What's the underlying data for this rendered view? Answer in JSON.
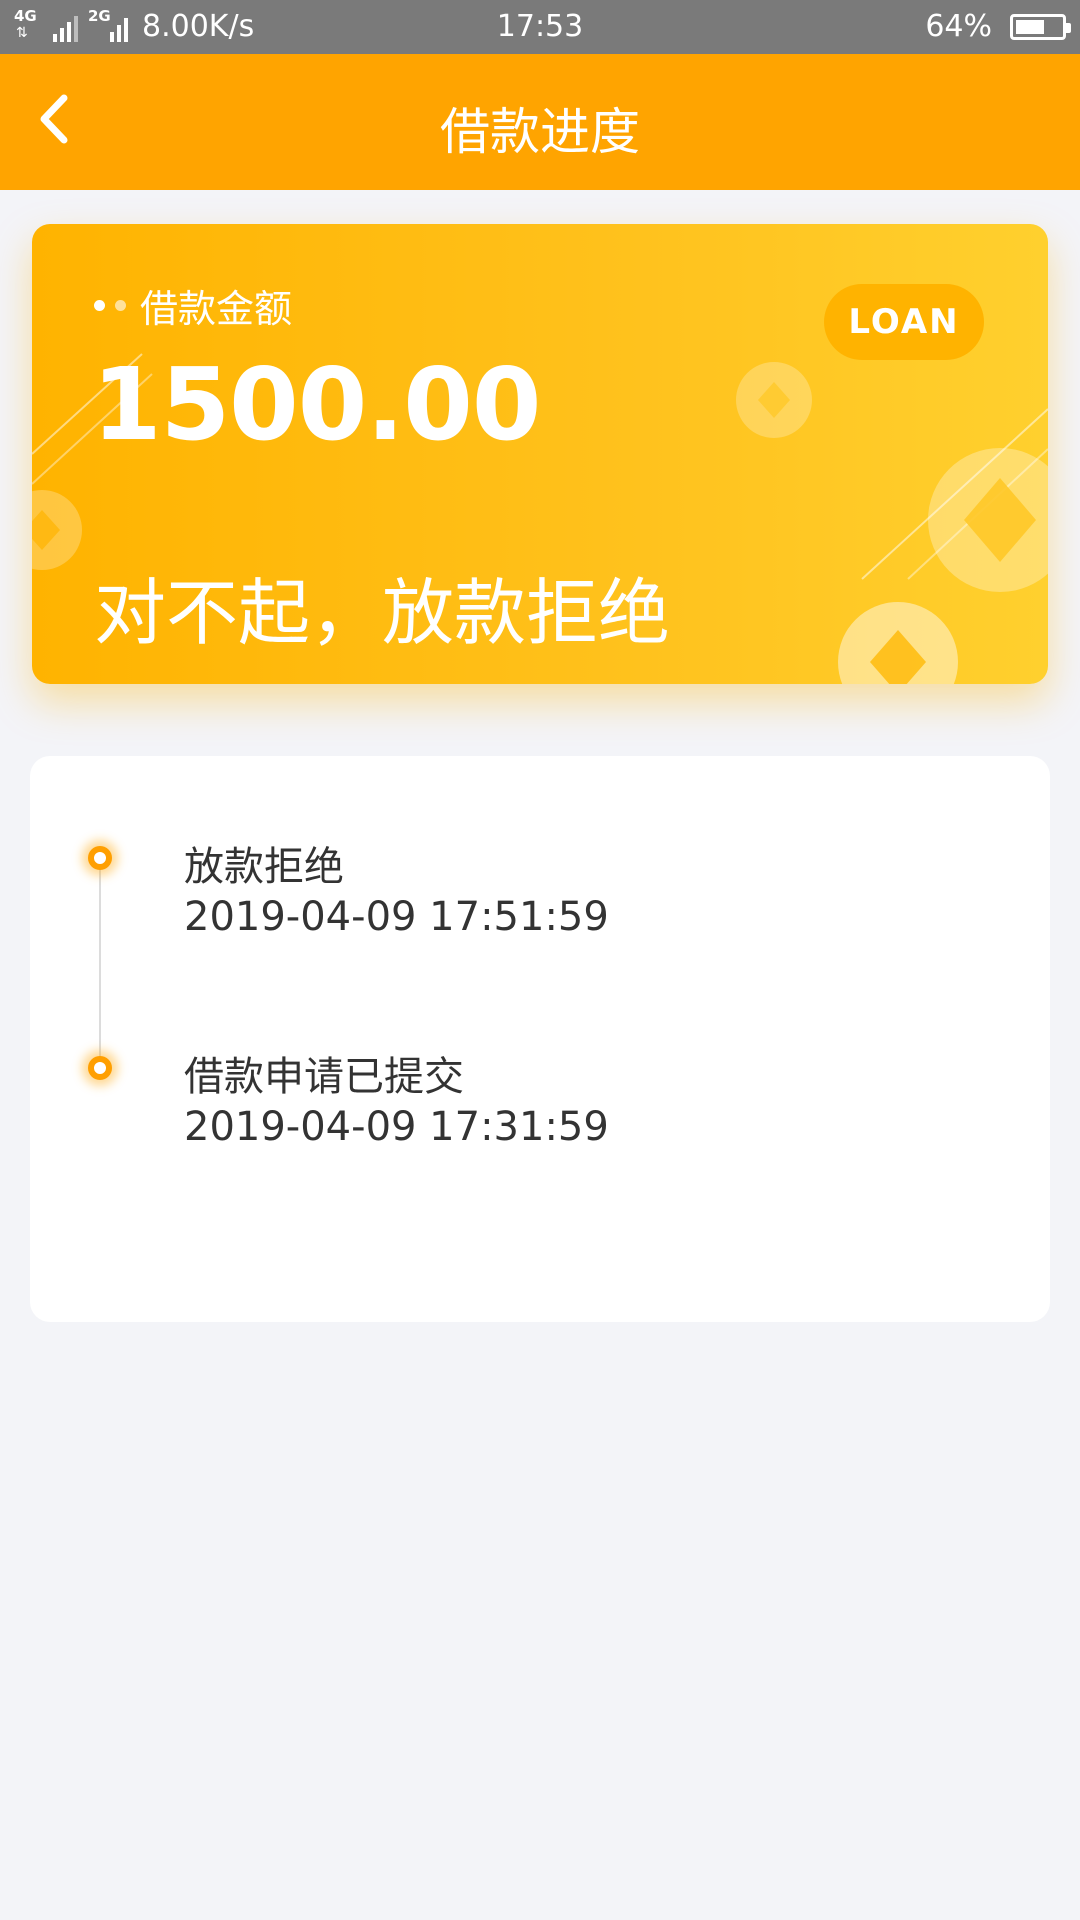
{
  "status_bar": {
    "network_1": "4G",
    "network_1b": "4G",
    "network_2": "2G",
    "speed": "8.00K/s",
    "time": "17:53",
    "battery": "64%",
    "battery_level": 0.64
  },
  "header": {
    "title": "借款进度",
    "back_icon": "chevron-left-icon"
  },
  "loan_card": {
    "amount_label": "借款金额",
    "amount": "1500.00",
    "badge": "LOAN",
    "status": "对不起，放款拒绝",
    "colors": {
      "start": "#ffb300",
      "end": "#ffd02e"
    }
  },
  "timeline": {
    "items": [
      {
        "title": "放款拒绝",
        "time": "2019-04-09 17:51:59"
      },
      {
        "title": "借款申请已提交",
        "time": "2019-04-09 17:31:59"
      }
    ]
  },
  "colors": {
    "accent": "#ffa400",
    "background": "#f3f4f8"
  }
}
